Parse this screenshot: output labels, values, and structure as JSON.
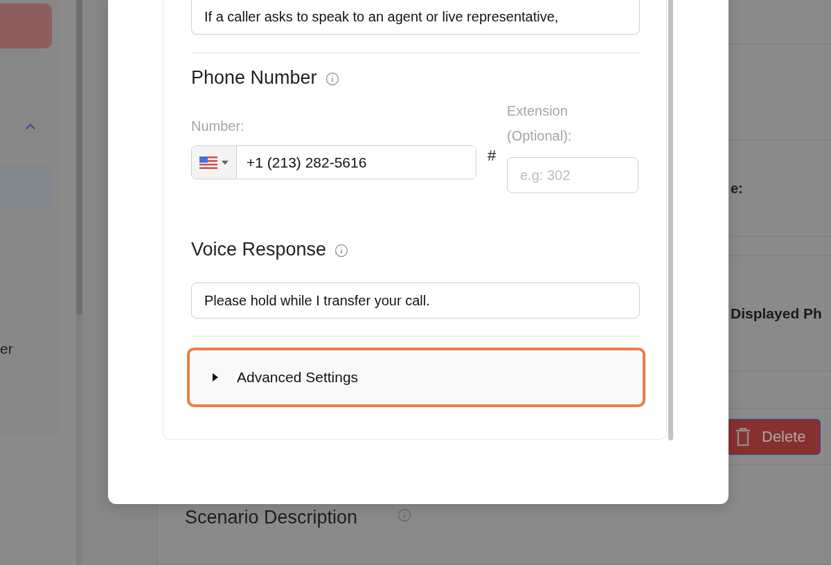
{
  "background": {
    "sidebar_label": "er",
    "rows": [
      {
        "text": "e:"
      },
      {
        "text": "Displayed Ph"
      }
    ],
    "delete_button": "Delete",
    "section_heading": "Scenario Description"
  },
  "modal": {
    "description_value": "If a caller asks to speak to an agent or live representative,",
    "phone_number": {
      "heading": "Phone Number",
      "number_label": "Number:",
      "value": "+1 (213) 282-5616",
      "hash": "#",
      "extension_label": "Extension (Optional):",
      "extension_placeholder": "e.g: 302"
    },
    "voice_response": {
      "heading": "Voice Response",
      "value": "Please hold while I transfer your call."
    },
    "advanced_settings": {
      "label": "Advanced Settings",
      "expanded": false
    }
  }
}
